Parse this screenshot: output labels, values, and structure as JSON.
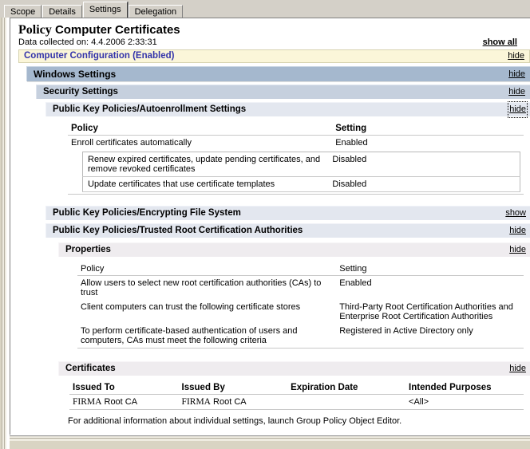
{
  "tabs": [
    {
      "label": "Scope",
      "active": false
    },
    {
      "label": "Details",
      "active": false
    },
    {
      "label": "Settings",
      "active": true
    },
    {
      "label": "Delegation",
      "active": false
    }
  ],
  "report": {
    "title_prefix": "Policy",
    "title": "Computer Certificates",
    "collected_label": "Data collected on: 4.4.2006 2:33:31",
    "show_all": "show all",
    "footnote": "For additional information about individual settings, launch Group Policy Object Editor."
  },
  "links": {
    "hide": "hide",
    "show": "show"
  },
  "sections": {
    "computer_configuration": "Computer Configuration (Enabled)",
    "windows_settings": "Windows Settings",
    "security_settings": "Security Settings",
    "autoenrollment": "Public Key Policies/Autoenrollment Settings",
    "encrypting_file_system": "Public Key Policies/Encrypting File System",
    "trusted_root": "Public Key Policies/Trusted Root Certification Authorities",
    "properties": "Properties",
    "certificates": "Certificates"
  },
  "autoenrollment_table": {
    "headers": {
      "policy": "Policy",
      "setting": "Setting"
    },
    "rows": [
      {
        "policy": "Enroll certificates automatically",
        "setting": "Enabled"
      }
    ],
    "subrows": [
      {
        "policy": "Renew expired certificates, update pending certificates, and remove revoked certificates",
        "setting": "Disabled"
      },
      {
        "policy": "Update certificates that use certificate templates",
        "setting": "Disabled"
      }
    ]
  },
  "properties_table": {
    "headers": {
      "policy": "Policy",
      "setting": "Setting"
    },
    "rows": [
      {
        "policy": "Allow users to select new root certification authorities (CAs) to trust",
        "setting": "Enabled"
      },
      {
        "policy": "Client computers can trust the following certificate stores",
        "setting": "Third-Party Root Certification Authorities and Enterprise Root Certification Authorities"
      },
      {
        "policy": "To perform certificate-based authentication of users and computers, CAs must meet the following criteria",
        "setting": "Registered in Active Directory only"
      }
    ]
  },
  "certificates_table": {
    "headers": {
      "issued_to": "Issued To",
      "issued_by": "Issued By",
      "expiration_date": "Expiration Date",
      "intended_purposes": "Intended Purposes"
    },
    "rows": [
      {
        "issued_to_serif": "FIRMA",
        "issued_to_rest": " Root CA",
        "issued_by_serif": "FIRMA",
        "issued_by_rest": "  Root CA",
        "expiration_date": "",
        "intended_purposes": "<All>"
      }
    ]
  },
  "colors": {
    "banner_yellow": "#fbf6d9",
    "banner_text": "#3333aa",
    "level1_bar": "#a5b8ce",
    "level2_bar": "#c6d0de",
    "level3_bar": "#e3e7ef",
    "level4_bar": "#efecef",
    "window_chrome": "#d4d0c8"
  }
}
